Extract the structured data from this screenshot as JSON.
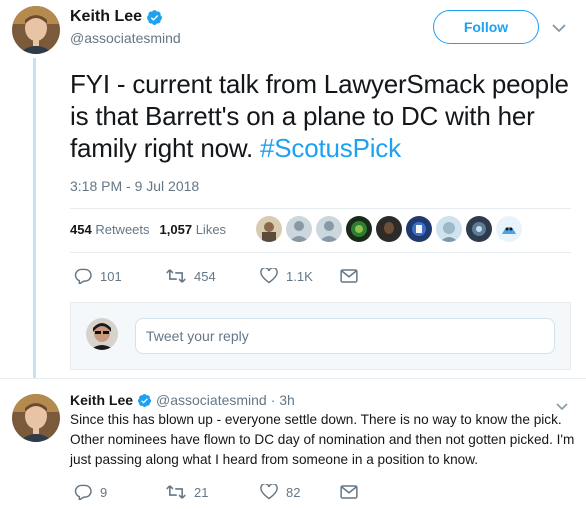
{
  "tweet": {
    "author_name": "Keith Lee",
    "handle": "@associatesmind",
    "follow_label": "Follow",
    "text": "FYI - current talk from LawyerSmack people is that Barrett's on a plane to DC with her family right now. ",
    "hashtag": "#ScotusPick",
    "timestamp": "3:18 PM - 9 Jul 2018",
    "retweets_count": "454",
    "retweets_label": "Retweets",
    "likes_count": "1,057",
    "likes_label": "Likes",
    "actions": {
      "replies": "101",
      "retweets": "454",
      "likes": "1.1K"
    }
  },
  "reply_box": {
    "placeholder": "Tweet your reply"
  },
  "reply": {
    "author_name": "Keith Lee",
    "handle": "@associatesmind",
    "time": "· 3h",
    "text": "Since this has blown up - everyone settle down. There is no way to know the pick. Other nominees have flown to DC day of nomination and then not gotten picked. I'm just passing along what I heard from someone in a position to know.",
    "actions": {
      "replies": "9",
      "retweets": "21",
      "likes": "82"
    }
  },
  "colors": {
    "accent": "#1da1f2",
    "muted": "#657786",
    "thread_line": "#c4e4f3"
  },
  "icons": [
    "verified-badge-icon",
    "chevron-down-icon",
    "reply-icon",
    "retweet-icon",
    "heart-icon",
    "message-icon"
  ]
}
